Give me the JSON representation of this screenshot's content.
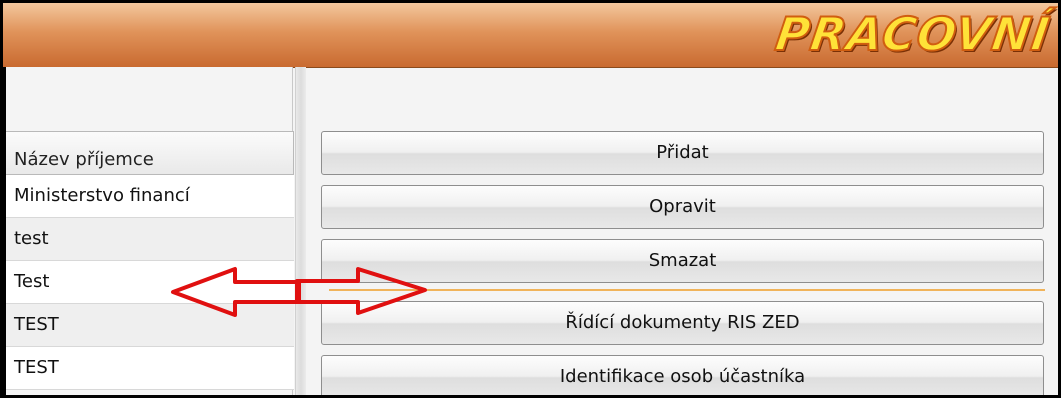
{
  "header": {
    "logo_text": "PRACOVNÍ"
  },
  "grid": {
    "column_header": "Název příjemce",
    "rows": [
      "Ministerstvo financí",
      "test",
      "Test",
      "TEST",
      "TEST"
    ]
  },
  "actions": {
    "add_label": "Přidat",
    "edit_label": "Opravit",
    "delete_label": "Smazat",
    "docs_label": "Řídící dokumenty RIS ZED",
    "identify_label": "Identifikace osob účastníka"
  },
  "colors": {
    "annotation_arrow": "#e01010",
    "divider": "#f0b35a",
    "titlebar_accent": "#d9894c"
  }
}
